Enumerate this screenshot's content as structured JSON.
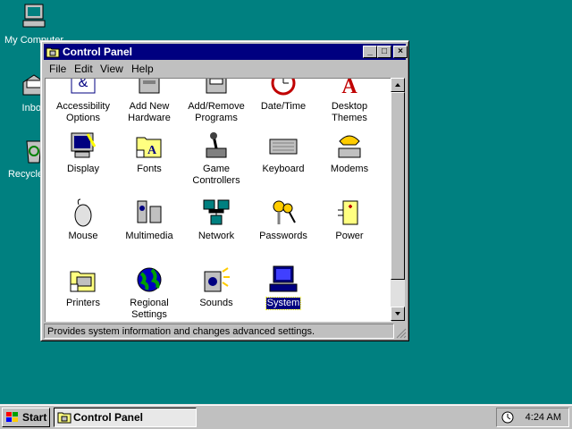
{
  "desktop": {
    "icons": [
      {
        "label": "My Computer",
        "icon": "computer-icon"
      },
      {
        "label": "Inbox",
        "icon": "inbox-icon"
      },
      {
        "label": "Recycle Bin",
        "icon": "recycle-bin-icon"
      }
    ]
  },
  "window": {
    "title": "Control Panel",
    "buttons": {
      "minimize": "_",
      "maximize": "□",
      "close": "×"
    },
    "menu": [
      "File",
      "Edit",
      "View",
      "Help"
    ],
    "items": [
      {
        "label": "Accessibility Options",
        "icon": "accessibility-icon"
      },
      {
        "label": "Add New Hardware",
        "icon": "hardware-icon"
      },
      {
        "label": "Add/Remove Programs",
        "icon": "add-remove-programs-icon"
      },
      {
        "label": "Date/Time",
        "icon": "clock-icon"
      },
      {
        "label": "Desktop Themes",
        "icon": "desktop-themes-icon"
      },
      {
        "label": "Display",
        "icon": "display-icon"
      },
      {
        "label": "Fonts",
        "icon": "fonts-folder-icon"
      },
      {
        "label": "Game Controllers",
        "icon": "joystick-icon"
      },
      {
        "label": "Keyboard",
        "icon": "keyboard-icon"
      },
      {
        "label": "Modems",
        "icon": "modem-phone-icon"
      },
      {
        "label": "Mouse",
        "icon": "mouse-icon"
      },
      {
        "label": "Multimedia",
        "icon": "multimedia-icon"
      },
      {
        "label": "Network",
        "icon": "network-icon"
      },
      {
        "label": "Passwords",
        "icon": "keys-icon"
      },
      {
        "label": "Power",
        "icon": "battery-icon"
      },
      {
        "label": "Printers",
        "icon": "printer-folder-icon"
      },
      {
        "label": "Regional Settings",
        "icon": "globe-icon"
      },
      {
        "label": "Sounds",
        "icon": "speaker-icon"
      },
      {
        "label": "System",
        "icon": "system-computer-icon",
        "selected": true
      }
    ],
    "status": "Provides system information and changes advanced settings."
  },
  "taskbar": {
    "start": "Start",
    "task": "Control Panel",
    "time": "4:24 AM"
  }
}
